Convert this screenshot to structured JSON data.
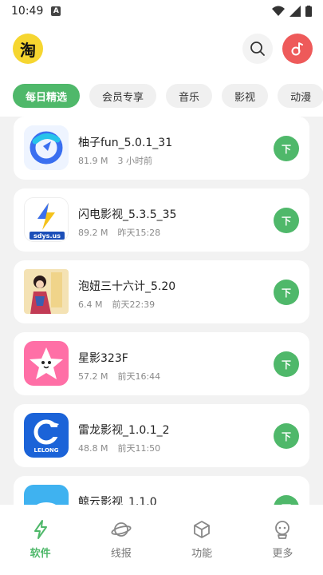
{
  "status": {
    "time": "10:49",
    "badge": "A"
  },
  "header": {
    "logo_char": "淘"
  },
  "tabs": [
    {
      "label": "每日精选",
      "active": true
    },
    {
      "label": "会员专享",
      "active": false
    },
    {
      "label": "音乐",
      "active": false
    },
    {
      "label": "影视",
      "active": false
    },
    {
      "label": "动漫",
      "active": false
    }
  ],
  "apps": [
    {
      "name": "柚子fun_5.0.1_31",
      "size": "81.9 M",
      "time": "3 小时前",
      "icon": "youzi-fun-icon"
    },
    {
      "name": "闪电影视_5.3.5_35",
      "size": "89.2 M",
      "time": "昨天15:28",
      "icon": "shandian-icon",
      "icon_text": "sdys.us"
    },
    {
      "name": "泡妞三十六计_5.20",
      "size": "6.4 M",
      "time": "前天22:39",
      "icon": "paoniu-icon"
    },
    {
      "name": "星影323F",
      "size": "57.2 M",
      "time": "前天16:44",
      "icon": "star-icon"
    },
    {
      "name": "雷龙影视_1.0.1_2",
      "size": "48.8 M",
      "time": "前天11:50",
      "icon": "leilong-icon",
      "icon_text": "LELONG"
    },
    {
      "name": "鲸云影视_1.1.0",
      "size": "",
      "time": "",
      "icon": "jingyun-icon"
    }
  ],
  "download_label": "下",
  "nav": [
    {
      "label": "软件",
      "icon": "lightning-icon",
      "active": true
    },
    {
      "label": "线报",
      "icon": "planet-icon",
      "active": false
    },
    {
      "label": "功能",
      "icon": "cube-icon",
      "active": false
    },
    {
      "label": "更多",
      "icon": "robot-icon",
      "active": false
    }
  ],
  "colors": {
    "accent": "#4fb86a",
    "music": "#ee5a5a",
    "logo": "#f6d630"
  }
}
